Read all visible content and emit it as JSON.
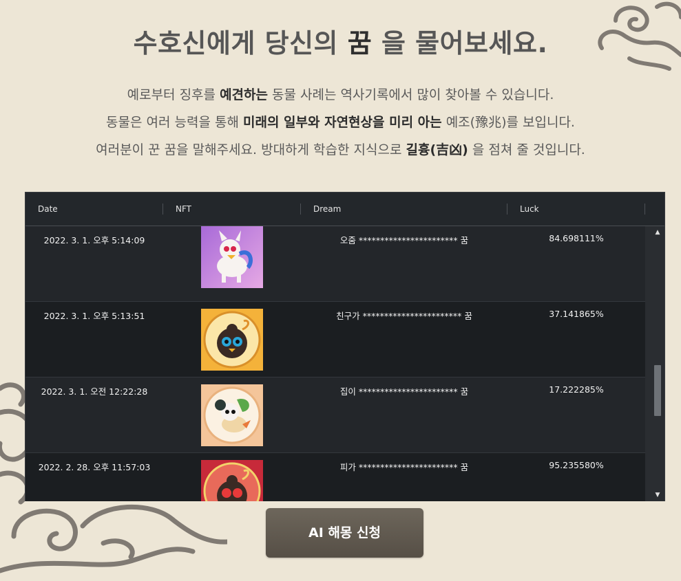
{
  "hero": {
    "title_prefix": "수호신에게 당신의 ",
    "title_strong": "꿈",
    "title_suffix": " 을 물어보세요."
  },
  "description": {
    "line1_a": "예로부터 징후를 ",
    "line1_b": "예견하는",
    "line1_c": " 동물 사례는 역사기록에서 많이 찾아볼 수 있습니다.",
    "line2_a": "동물은 여러 능력을 통해 ",
    "line2_b": "미래의 일부와 자연현상을 미리 아는",
    "line2_c": " 예조(豫兆)를 보입니다.",
    "line3_a": "여러분이 꾼 꿈을 말해주세요. 방대하게 학습한 지식으로 ",
    "line3_b": "길흉(吉凶)",
    "line3_c": " 을 점쳐 줄 것입니다."
  },
  "grid": {
    "columns": {
      "date": "Date",
      "nft": "NFT",
      "dream": "Dream",
      "luck": "Luck"
    },
    "rows": [
      {
        "date": "2022. 3. 1. 오후 5:14:09",
        "nft": "purple-white-horse-nft",
        "dream": "오줌 *********************** 꿈",
        "luck": "84.698111%"
      },
      {
        "date": "2022. 3. 1. 오후 5:13:51",
        "nft": "orange-dark-creature-nft",
        "dream": "친구가 *********************** 꿈",
        "luck": "37.141865%"
      },
      {
        "date": "2022. 3. 1. 오전 12:22:28",
        "nft": "peach-mouse-nft",
        "dream": "집이 *********************** 꿈",
        "luck": "17.222285%"
      },
      {
        "date": "2022. 2. 28. 오후 11:57:03",
        "nft": "red-dark-creature-nft",
        "dream": "피가 *********************** 꿈",
        "luck": "95.235580%"
      }
    ],
    "scroll_position": 0.5
  },
  "cta": {
    "label": "AI 해몽 신청"
  },
  "colors": {
    "background": "#ede6d6",
    "grid_bg": "#1b1e21",
    "grid_header": "#23272b",
    "button": "#5f584e"
  }
}
